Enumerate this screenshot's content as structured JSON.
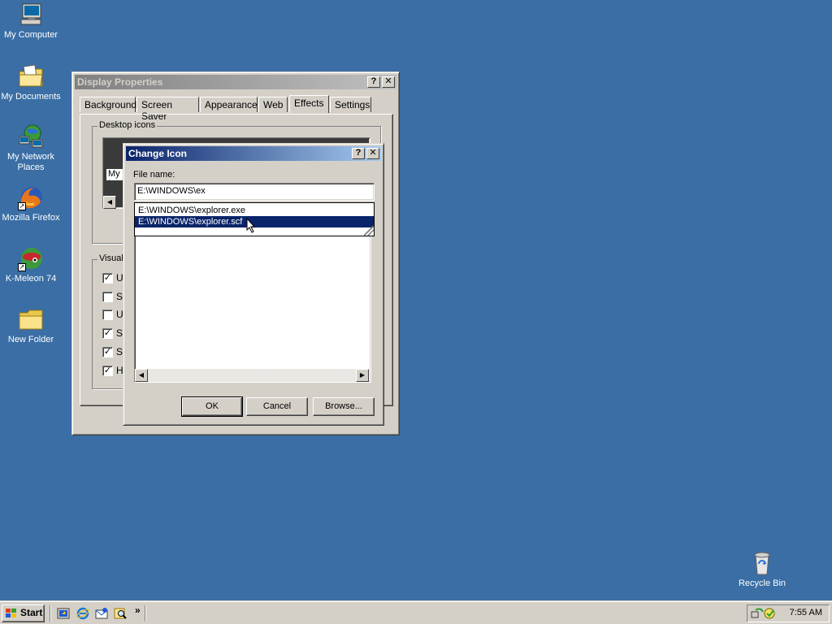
{
  "desktop": {
    "background_color": "#3a6ea5",
    "icons": [
      {
        "label": "My Computer",
        "icon": "my-computer-icon"
      },
      {
        "label": "My Documents",
        "icon": "my-documents-icon"
      },
      {
        "label": "My Network Places",
        "icon": "network-places-icon"
      },
      {
        "label": "Mozilla Firefox",
        "icon": "firefox-icon"
      },
      {
        "label": "K-Meleon 74",
        "icon": "k-meleon-icon"
      },
      {
        "label": "New Folder",
        "icon": "folder-icon"
      },
      {
        "label": "Recycle Bin",
        "icon": "recycle-bin-icon"
      }
    ]
  },
  "display_properties": {
    "title": "Display Properties",
    "help_glyph": "?",
    "close_glyph": "✕",
    "tabs": [
      {
        "label": "Background"
      },
      {
        "label": "Screen Saver"
      },
      {
        "label": "Appearance"
      },
      {
        "label": "Web"
      },
      {
        "label": "Effects",
        "active": true
      },
      {
        "label": "Settings"
      }
    ],
    "desktop_icons_group": "Desktop icons",
    "desktop_icons_partial_label": "My I",
    "visual_effects_group": "Visual",
    "checkboxes": [
      {
        "label": "U",
        "checked": true
      },
      {
        "label": "S",
        "checked": false
      },
      {
        "label": "U",
        "checked": false
      },
      {
        "label": "S",
        "checked": true
      },
      {
        "label": "S",
        "checked": true
      },
      {
        "label": "H",
        "checked": true
      }
    ]
  },
  "change_icon": {
    "title": "Change Icon",
    "help_glyph": "?",
    "close_glyph": "✕",
    "file_name_label": "File name:",
    "file_name_value": "E:\\WINDOWS\\ex",
    "suggestions": [
      {
        "text": "E:\\WINDOWS\\explorer.exe",
        "selected": false
      },
      {
        "text": "E:\\WINDOWS\\explorer.scf",
        "selected": true
      }
    ],
    "ok_label": "OK",
    "cancel_label": "Cancel",
    "browse_label": "Browse..."
  },
  "taskbar": {
    "start_label": "Start",
    "quick_launch": [
      "show-desktop-icon",
      "internet-explorer-icon",
      "outlook-express-icon",
      "search-icon"
    ],
    "chevron": "»",
    "clock": "7:55 AM"
  },
  "colors": {
    "window_face": "#d4d0c8",
    "active_title_start": "#0a246a",
    "active_title_end": "#a6caf0",
    "selection": "#0a246a"
  }
}
